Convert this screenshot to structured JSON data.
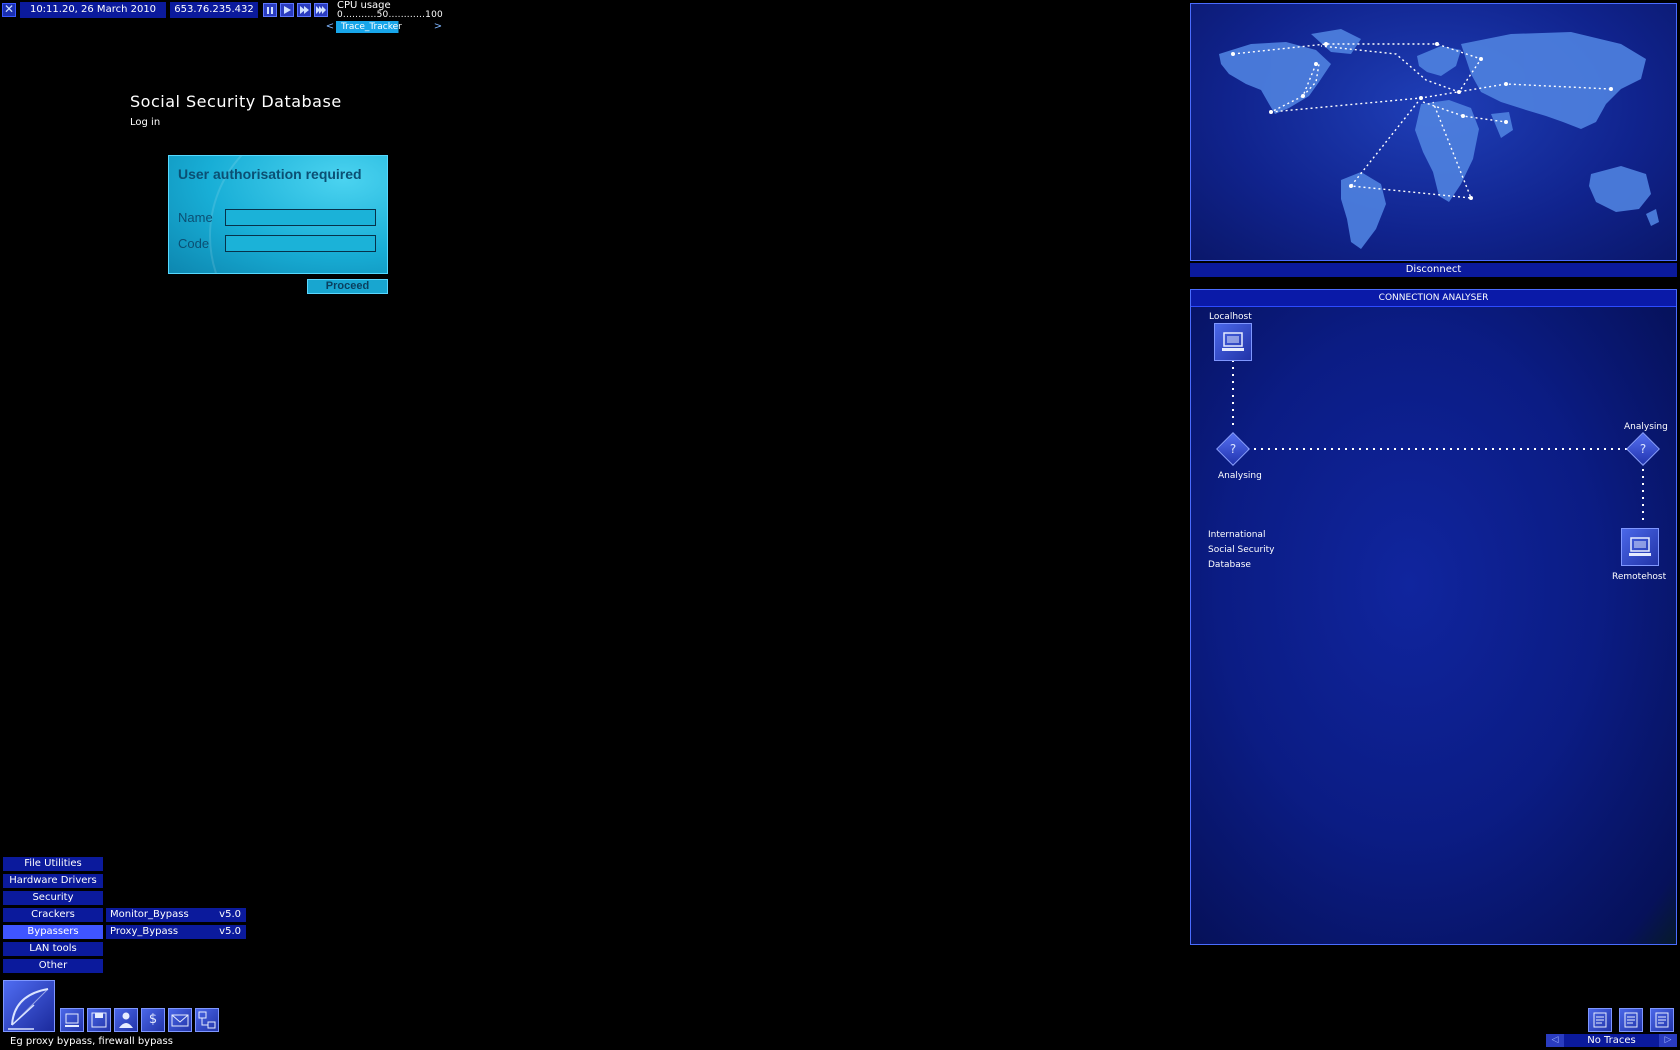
{
  "topbar": {
    "datetime": "10:11.20, 26 March 2010",
    "ip": "653.76.235.432",
    "cpu_label": "CPU usage",
    "cpu_scale": "0...........50............100",
    "trace_tool": "Trace_Tracker",
    "trace_prev": "<",
    "trace_next": ">",
    "speed_controls": [
      "pause-icon",
      "play-icon",
      "fast-forward-icon",
      "megafast-icon"
    ]
  },
  "site": {
    "title": "Social Security Database",
    "subtitle": "Log in"
  },
  "login": {
    "title": "User authorisation required",
    "name_label": "Name",
    "code_label": "Code",
    "name_value": "",
    "code_value": "",
    "proceed_label": "Proceed"
  },
  "map": {
    "disconnect_label": "Disconnect"
  },
  "analyser": {
    "header": "CONNECTION ANALYSER",
    "localhost_label": "Localhost",
    "analysing_left": "Analysing",
    "analysing_right": "Analysing",
    "remote_line1": "International",
    "remote_line2": "Social Security",
    "remote_line3": "Database",
    "remotehost_label": "Remotehost",
    "unknown_symbol": "?"
  },
  "menu": {
    "items": [
      "File Utilities",
      "Hardware Drivers",
      "Security",
      "Crackers",
      "Bypassers",
      "LAN tools",
      "Other"
    ],
    "active": "Bypassers",
    "submenu": [
      {
        "name": "Monitor_Bypass",
        "version": "v5.0"
      },
      {
        "name": "Proxy_Bypass",
        "version": "v5.0"
      }
    ]
  },
  "toolbar": {
    "buttons": [
      "computer-icon",
      "disk-icon",
      "person-icon",
      "dollar-icon",
      "mail-icon",
      "network-icon"
    ],
    "dollar_symbol": "$",
    "hint": "Eg proxy bypass, firewall bypass"
  },
  "status": {
    "traces_text": "No Traces",
    "colors": {
      "accent": "#0b1a9c",
      "highlight": "#3f55ff",
      "login_cyan": "#18aed6"
    }
  }
}
